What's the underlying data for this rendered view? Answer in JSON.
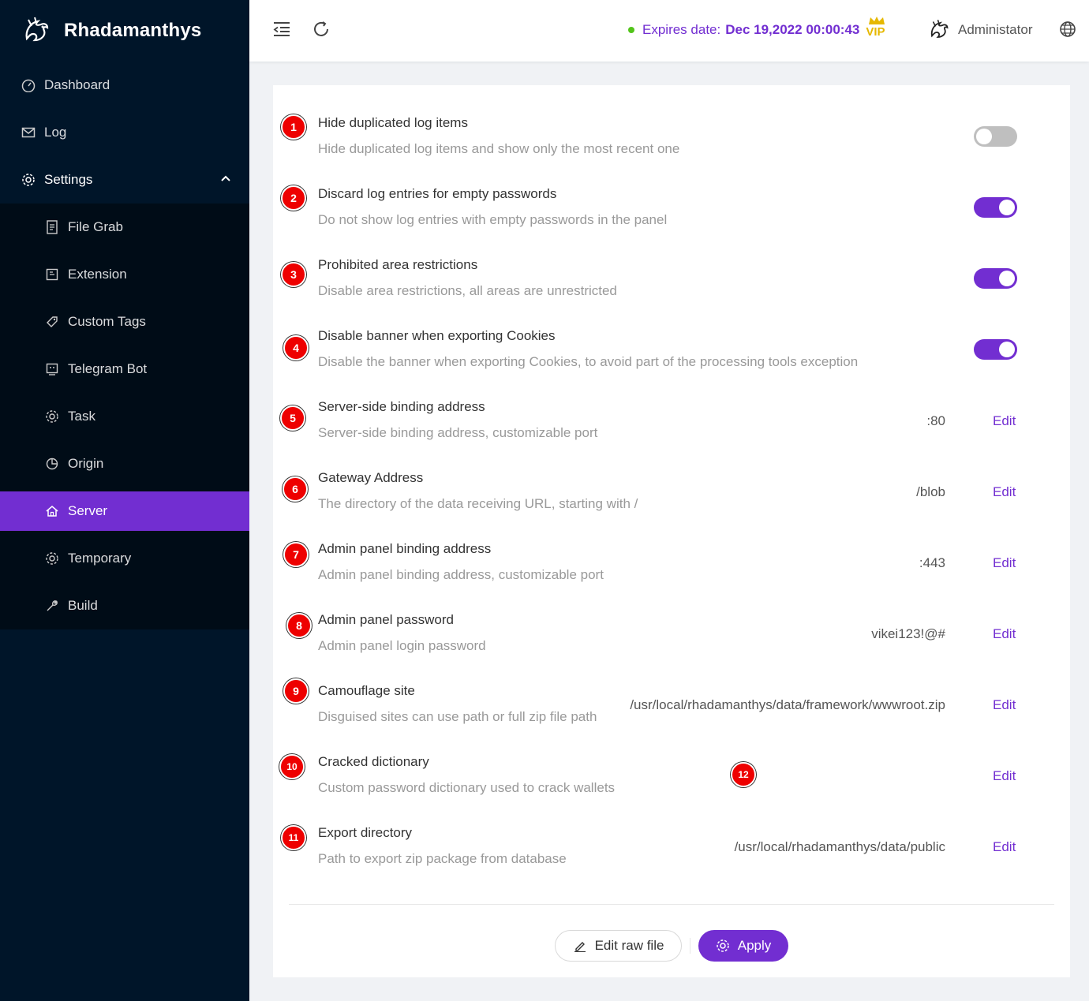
{
  "app": {
    "name": "Rhadamanthys"
  },
  "sidebar": {
    "items": [
      {
        "label": "Dashboard",
        "icon": "dashboard-icon"
      },
      {
        "label": "Log",
        "icon": "mail-icon"
      },
      {
        "label": "Settings",
        "icon": "gear-icon",
        "expanded": true
      }
    ],
    "settings_items": [
      {
        "label": "File Grab",
        "icon": "file-icon"
      },
      {
        "label": "Extension",
        "icon": "extension-icon"
      },
      {
        "label": "Custom Tags",
        "icon": "tag-icon"
      },
      {
        "label": "Telegram Bot",
        "icon": "bot-icon"
      },
      {
        "label": "Task",
        "icon": "gear-icon"
      },
      {
        "label": "Origin",
        "icon": "pie-chart-icon"
      },
      {
        "label": "Server",
        "icon": "home-icon",
        "active": true
      },
      {
        "label": "Temporary",
        "icon": "gear-icon"
      },
      {
        "label": "Build",
        "icon": "wrench-icon"
      }
    ]
  },
  "header": {
    "expires_label": "Expires date:",
    "expires_date": "Dec 19,2022 00:00:43",
    "vip": "VIP",
    "user": "Administator"
  },
  "settings": [
    {
      "n": "1",
      "title": "Hide duplicated log items",
      "desc": "Hide duplicated log items and show only the most recent one",
      "toggle": false
    },
    {
      "n": "2",
      "title": "Discard log entries for empty passwords",
      "desc": "Do not show log entries with empty passwords in the panel",
      "toggle": true
    },
    {
      "n": "3",
      "title": "Prohibited area restrictions",
      "desc": "Disable area restrictions, all areas are unrestricted",
      "toggle": true
    },
    {
      "n": "4",
      "title": "Disable banner when exporting Cookies",
      "desc": "Disable the banner when exporting Cookies, to avoid part of the processing tools exception",
      "toggle": true
    },
    {
      "n": "5",
      "title": "Server-side binding address",
      "desc": "Server-side binding address, customizable port",
      "value": ":80",
      "edit": "Edit"
    },
    {
      "n": "6",
      "title": "Gateway Address",
      "desc": "The directory of the data receiving URL, starting with /",
      "value": "/blob",
      "edit": "Edit"
    },
    {
      "n": "7",
      "title": "Admin panel binding address",
      "desc": "Admin panel binding address, customizable port",
      "value": ":443",
      "edit": "Edit"
    },
    {
      "n": "8",
      "title": "Admin panel password",
      "desc": "Admin panel login password",
      "value": "vikei123!@#",
      "edit": "Edit"
    },
    {
      "n": "9",
      "title": "Camouflage site",
      "desc": "Disguised sites can use path or full zip file path",
      "value": "/usr/local/rhadamanthys/data/framework/wwwroot.zip",
      "edit": "Edit"
    },
    {
      "n": "10",
      "title": "Cracked dictionary",
      "desc": "Custom password dictionary used to crack wallets",
      "value": "",
      "edit": "Edit"
    },
    {
      "n": "11",
      "title": "Export directory",
      "desc": "Path to export zip package from database",
      "value": "/usr/local/rhadamanthys/data/public",
      "edit": "Edit"
    }
  ],
  "extra_badge": "12",
  "footer": {
    "raw_label": "Edit raw file",
    "apply_label": "Apply"
  },
  "colors": {
    "accent": "#722ed1",
    "sidebar": "#001529",
    "submenu": "#000c17",
    "badge": "#ee0000"
  }
}
